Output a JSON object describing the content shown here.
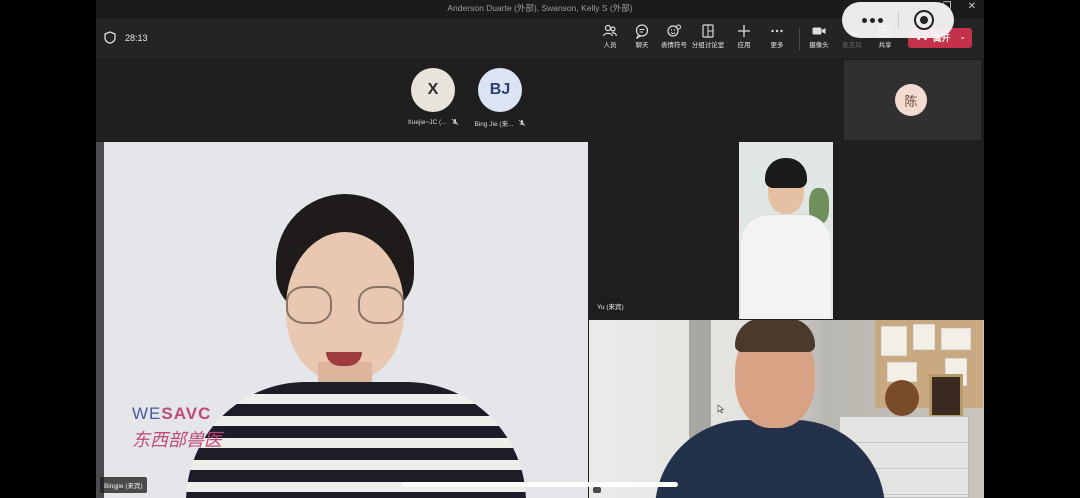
{
  "window": {
    "title": "Anderson Duarte (外部), Swanson, Kelly S (外部)",
    "minimize": "–",
    "maximize": "❐",
    "close": "✕"
  },
  "toolbar": {
    "timer": "28:13",
    "items": [
      {
        "label": "人员",
        "icon": "people-icon"
      },
      {
        "label": "聊天",
        "icon": "chat-icon"
      },
      {
        "label": "表情符号",
        "icon": "emoji-icon"
      },
      {
        "label": "分组讨论室",
        "icon": "breakout-rooms-icon"
      },
      {
        "label": "应用",
        "icon": "apps-plus-icon"
      },
      {
        "label": "更多",
        "icon": "more-icon"
      },
      {
        "label": "摄像头",
        "icon": "camera-icon"
      },
      {
        "label": "麦克风",
        "icon": "mic-off-icon"
      },
      {
        "label": "共享",
        "icon": "share-icon"
      }
    ],
    "leave_label": "离开"
  },
  "roster": {
    "participants": [
      {
        "initials": "X",
        "name": "Xuejie~JC (...",
        "bg": "#e8e4dc",
        "fg": "#2a2a2a"
      },
      {
        "initials": "BJ",
        "name": "Bing Jie (来...",
        "bg": "#dbe3f5",
        "fg": "#2b3f73"
      }
    ],
    "self_initial": "陈"
  },
  "tiles": {
    "main": {
      "name": "Bingjie (来宾)"
    },
    "top_right": {
      "name": "Yu (来宾)"
    },
    "bottom_right": {
      "name": ""
    }
  },
  "watermark": {
    "line1_a": "WE",
    "line1_b": "SAVC",
    "line2": "东西部兽医"
  },
  "colors": {
    "leave_button": "#c4314b",
    "background": "#1f1f1f"
  }
}
